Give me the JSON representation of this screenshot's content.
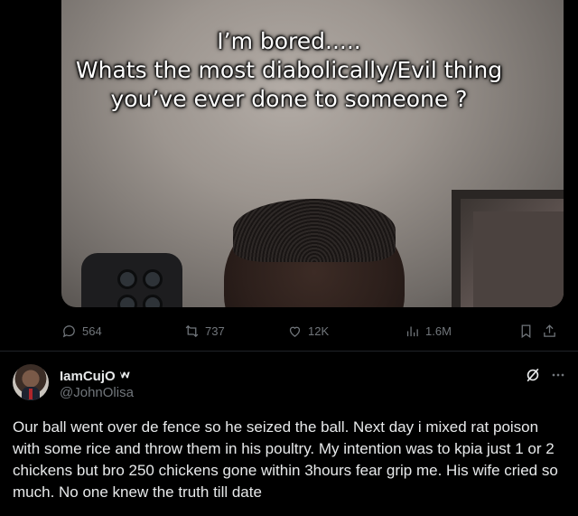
{
  "media": {
    "caption_line1": "I’m bored.....",
    "caption_line2": "Whats the most diabolically/Evil thing",
    "caption_line3": "you’ve ever done to someone ?"
  },
  "actions": {
    "replies": "564",
    "reposts": "737",
    "likes": "12K",
    "views": "1.6M"
  },
  "tweet": {
    "display_name": "IamCujO",
    "handle": "@JohnOlisa",
    "text": "Our ball went over de fence so he seized the ball. Next day i mixed rat poison with some rice and throw them in his poultry. My intention was to kpia just 1 or 2 chickens but bro 250 chickens gone within 3hours fear grip me. His wife cried so much. No one knew the truth till date"
  },
  "colors": {
    "background": "#000000",
    "text_primary": "#e7e9ea",
    "text_secondary": "#71767b",
    "divider": "#1f2327"
  },
  "icons": [
    "reply-icon",
    "repost-icon",
    "like-icon",
    "views-icon",
    "bookmark-icon",
    "share-icon",
    "verified-icon",
    "grok-icon",
    "more-icon"
  ]
}
